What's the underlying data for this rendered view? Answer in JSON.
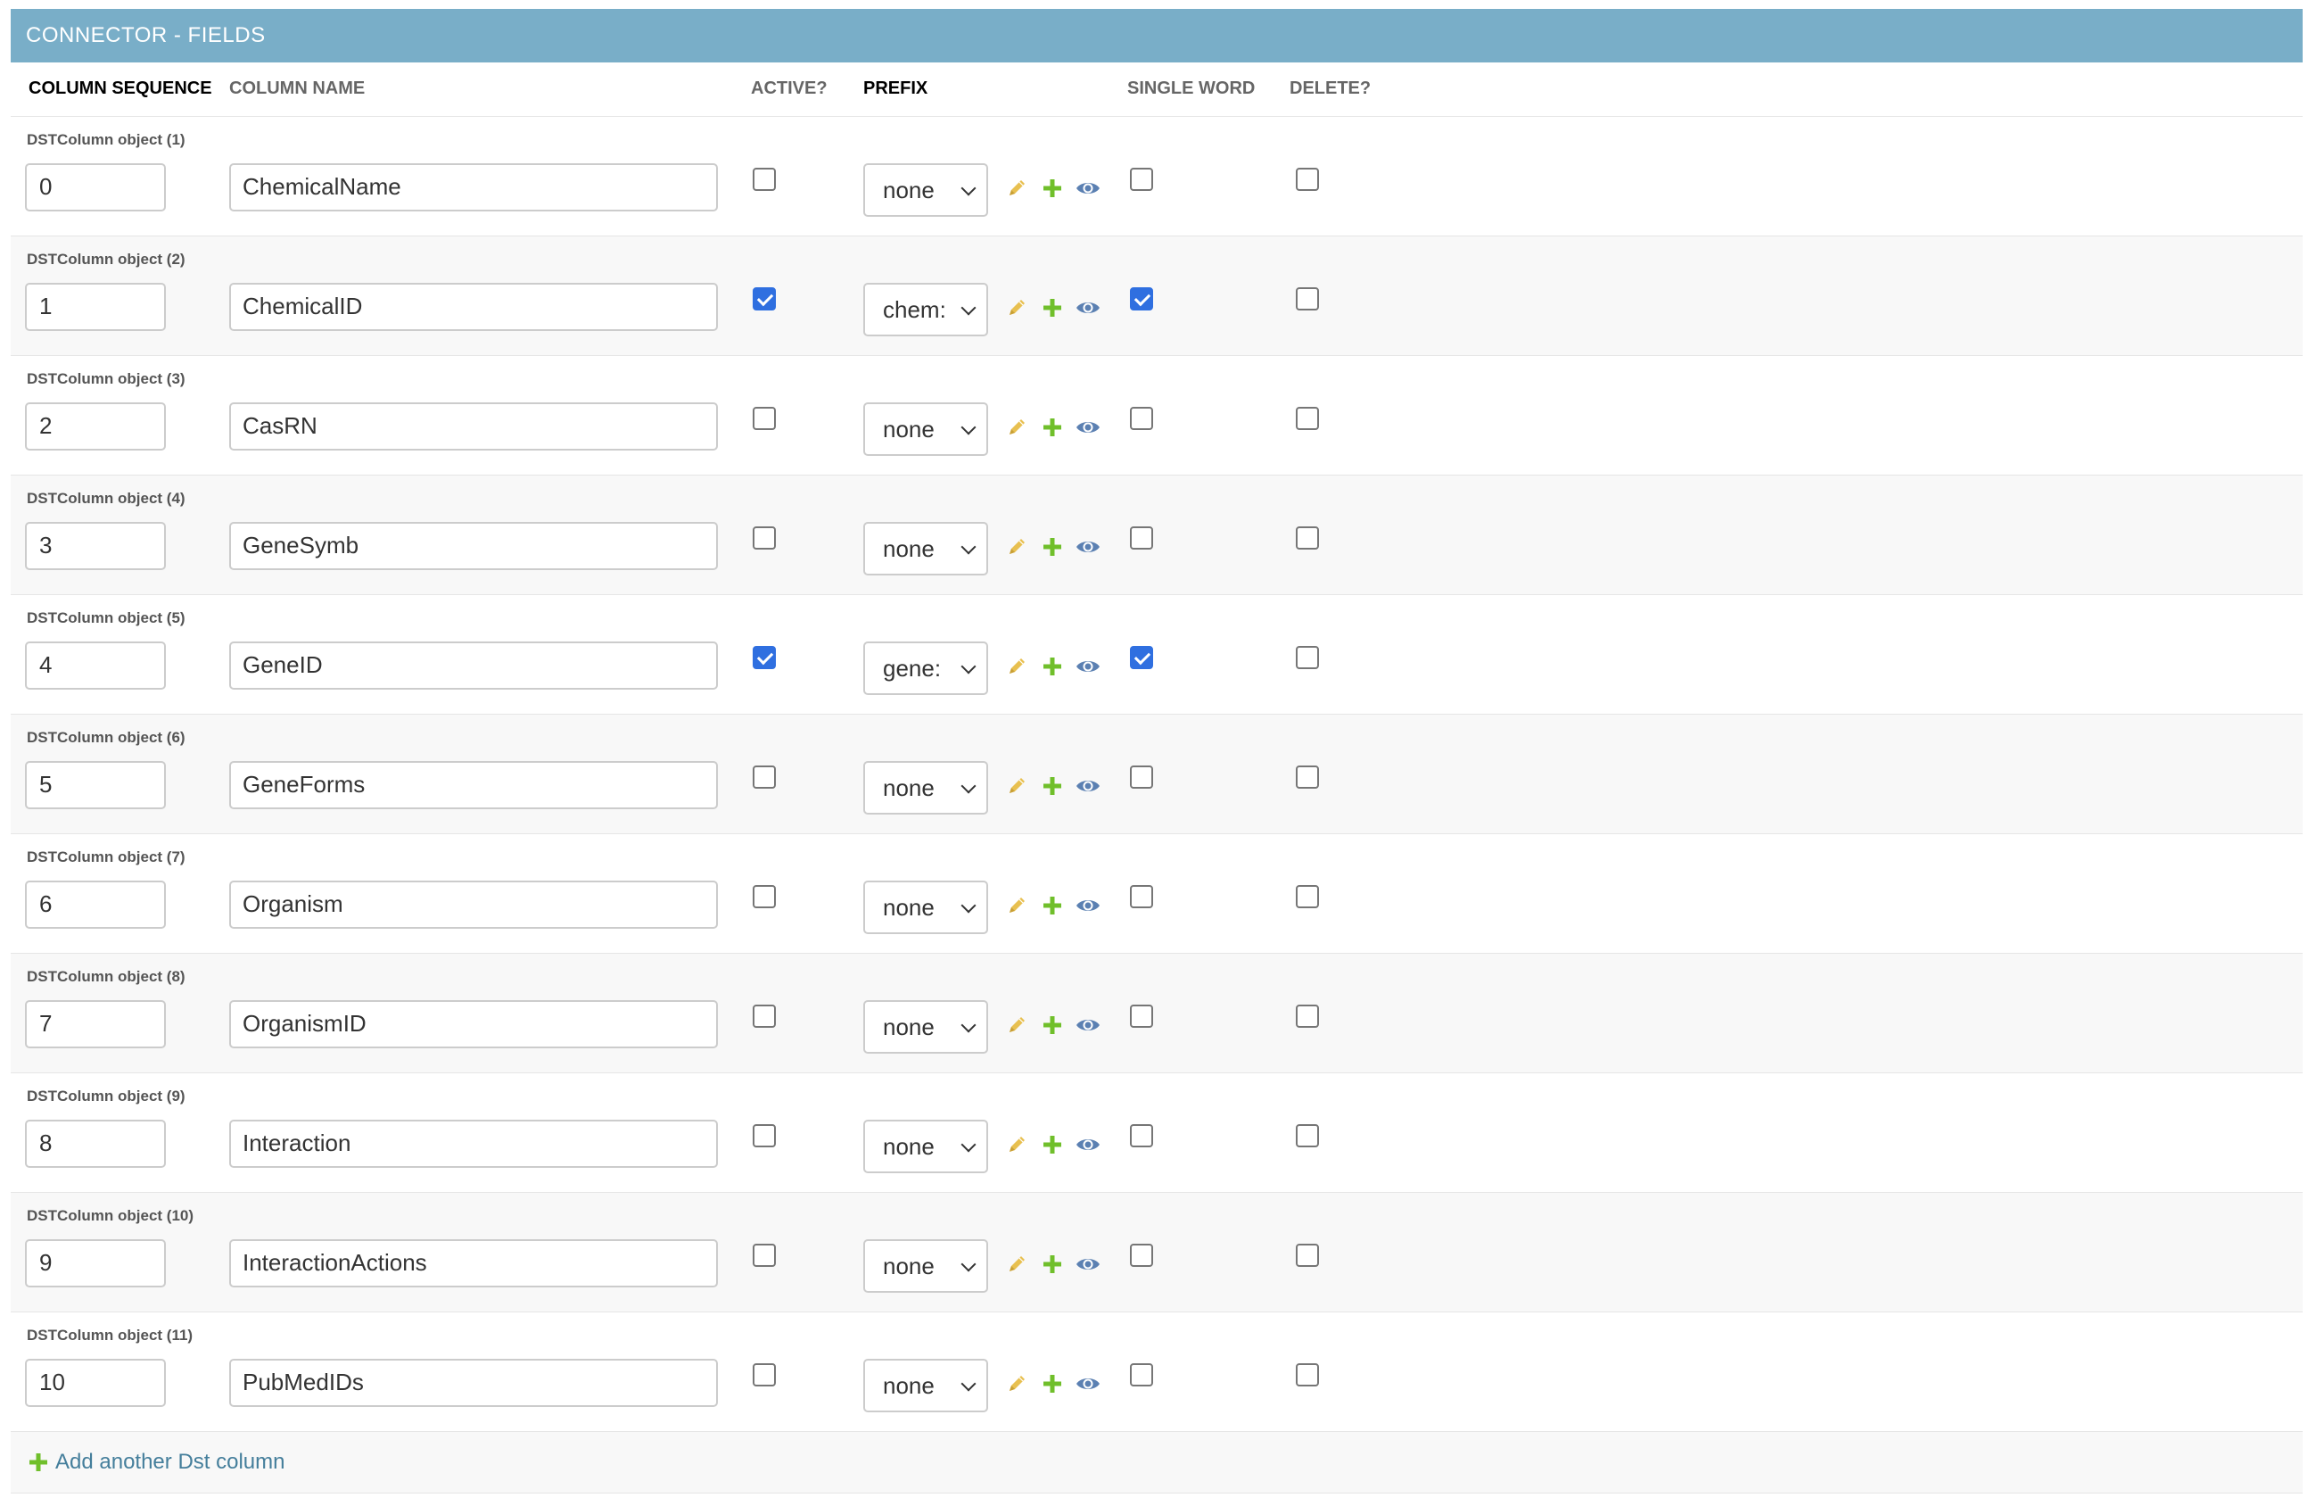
{
  "header": {
    "title": "CONNECTOR - FIELDS"
  },
  "columns": {
    "sequence": "COLUMN SEQUENCE",
    "name": "COLUMN NAME",
    "active": "ACTIVE?",
    "prefix": "PREFIX",
    "single_word": "SINGLE WORD",
    "delete": "DELETE?"
  },
  "rows": [
    {
      "label": "DSTColumn object (1)",
      "sequence": "0",
      "name": "ChemicalName",
      "active": false,
      "prefix": "none",
      "single_word": false,
      "delete": false
    },
    {
      "label": "DSTColumn object (2)",
      "sequence": "1",
      "name": "ChemicalID",
      "active": true,
      "prefix": "chem:",
      "single_word": true,
      "delete": false
    },
    {
      "label": "DSTColumn object (3)",
      "sequence": "2",
      "name": "CasRN",
      "active": false,
      "prefix": "none",
      "single_word": false,
      "delete": false
    },
    {
      "label": "DSTColumn object (4)",
      "sequence": "3",
      "name": "GeneSymb",
      "active": false,
      "prefix": "none",
      "single_word": false,
      "delete": false
    },
    {
      "label": "DSTColumn object (5)",
      "sequence": "4",
      "name": "GeneID",
      "active": true,
      "prefix": "gene:",
      "single_word": true,
      "delete": false
    },
    {
      "label": "DSTColumn object (6)",
      "sequence": "5",
      "name": "GeneForms",
      "active": false,
      "prefix": "none",
      "single_word": false,
      "delete": false
    },
    {
      "label": "DSTColumn object (7)",
      "sequence": "6",
      "name": "Organism",
      "active": false,
      "prefix": "none",
      "single_word": false,
      "delete": false
    },
    {
      "label": "DSTColumn object (8)",
      "sequence": "7",
      "name": "OrganismID",
      "active": false,
      "prefix": "none",
      "single_word": false,
      "delete": false
    },
    {
      "label": "DSTColumn object (9)",
      "sequence": "8",
      "name": "Interaction",
      "active": false,
      "prefix": "none",
      "single_word": false,
      "delete": false
    },
    {
      "label": "DSTColumn object (10)",
      "sequence": "9",
      "name": "InteractionActions",
      "active": false,
      "prefix": "none",
      "single_word": false,
      "delete": false
    },
    {
      "label": "DSTColumn object (11)",
      "sequence": "10",
      "name": "PubMedIDs",
      "active": false,
      "prefix": "none",
      "single_word": false,
      "delete": false
    }
  ],
  "add_link": {
    "label": "Add another Dst column"
  },
  "icons": {
    "change": "pencil-icon",
    "add": "plus-icon",
    "view": "eye-icon"
  },
  "colors": {
    "header_bg": "#79aec8",
    "checked": "#2f6fe0",
    "pencil": "#e8c050",
    "plus": "#70bf2b",
    "eye": "#5b80b2",
    "link": "#447e9b"
  }
}
